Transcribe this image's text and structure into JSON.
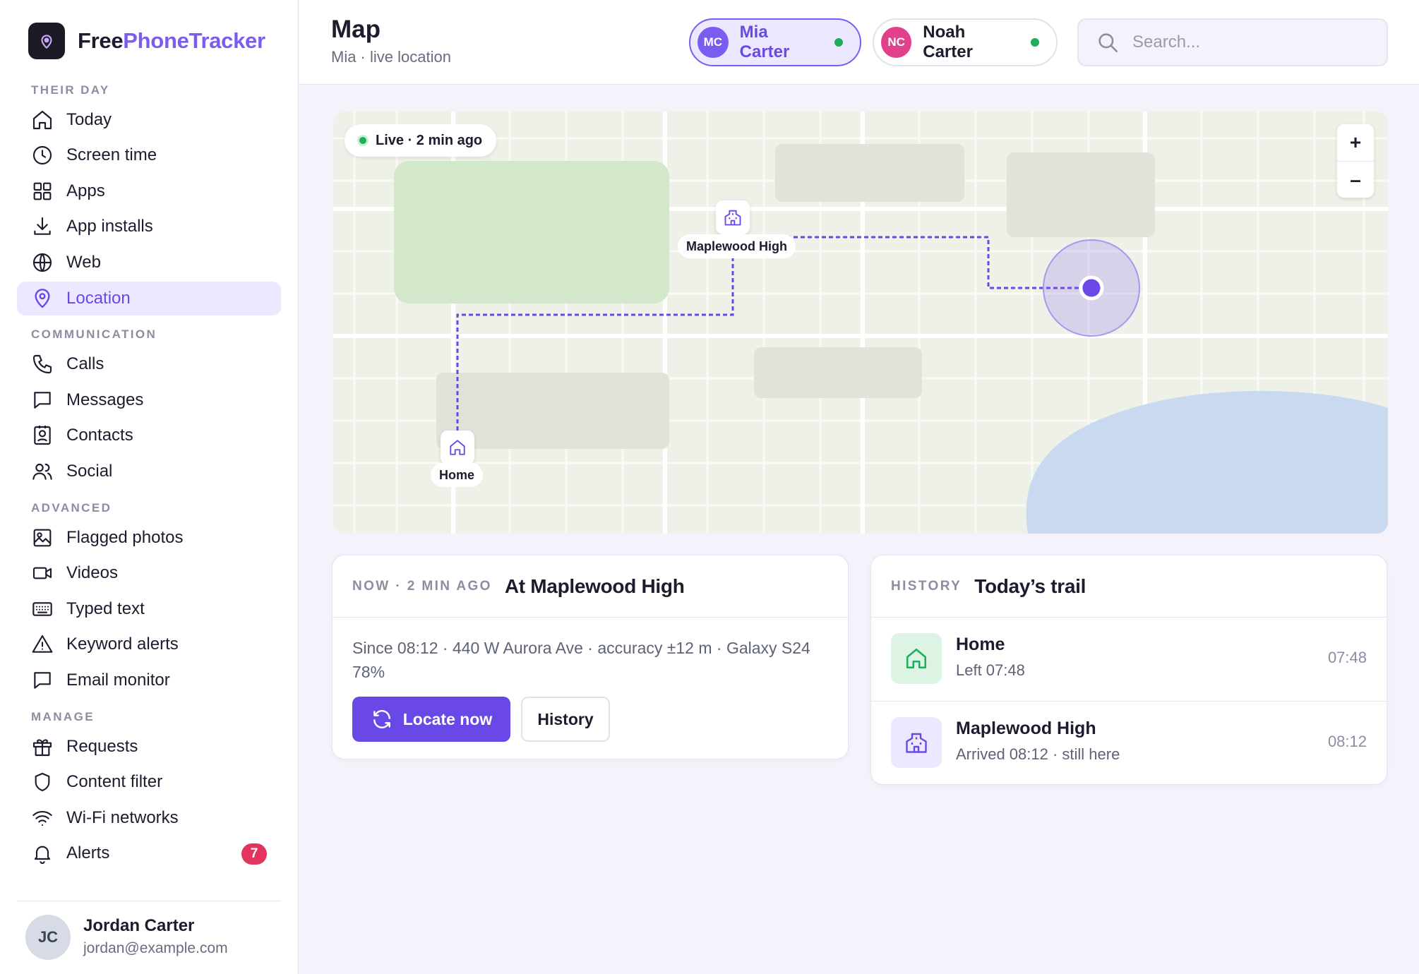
{
  "brand": {
    "name_a": "Free",
    "name_b": "PhoneTracker"
  },
  "nav": {
    "sections": [
      {
        "title": "THEIR DAY",
        "items": [
          {
            "label": "Today",
            "icon": "home-icon"
          },
          {
            "label": "Screen time",
            "icon": "clock-icon"
          },
          {
            "label": "Apps",
            "icon": "grid-icon"
          },
          {
            "label": "App installs",
            "icon": "download-icon"
          },
          {
            "label": "Web",
            "icon": "globe-icon"
          },
          {
            "label": "Location",
            "icon": "location-pin-icon",
            "active": true
          }
        ]
      },
      {
        "title": "COMMUNICATION",
        "items": [
          {
            "label": "Calls",
            "icon": "phone-icon"
          },
          {
            "label": "Messages",
            "icon": "message-icon"
          },
          {
            "label": "Contacts",
            "icon": "contact-card-icon"
          },
          {
            "label": "Social",
            "icon": "users-icon"
          }
        ]
      },
      {
        "title": "ADVANCED",
        "items": [
          {
            "label": "Flagged photos",
            "icon": "image-icon"
          },
          {
            "label": "Videos",
            "icon": "video-icon"
          },
          {
            "label": "Typed text",
            "icon": "keyboard-icon"
          },
          {
            "label": "Keyword alerts",
            "icon": "warning-icon"
          },
          {
            "label": "Email monitor",
            "icon": "message-icon"
          }
        ]
      },
      {
        "title": "MANAGE",
        "items": [
          {
            "label": "Requests",
            "icon": "gift-icon"
          },
          {
            "label": "Content filter",
            "icon": "shield-icon"
          },
          {
            "label": "Wi-Fi networks",
            "icon": "wifi-icon"
          },
          {
            "label": "Alerts",
            "icon": "bell-icon",
            "badge": "7"
          }
        ]
      }
    ]
  },
  "user": {
    "initials": "JC",
    "name": "Jordan Carter",
    "email": "jordan@example.com"
  },
  "header": {
    "title": "Map",
    "subtitle": "Mia · live location",
    "kids": [
      {
        "initials": "MC",
        "name": "Mia Carter",
        "active": true,
        "color": "#7b5cf0"
      },
      {
        "initials": "NC",
        "name": "Noah Carter",
        "active": false,
        "color": "#e0418a"
      }
    ],
    "search_placeholder": "Search..."
  },
  "map": {
    "live_label": "Live · 2 min ago",
    "zoom_in": "+",
    "zoom_out": "–",
    "places": [
      {
        "label": "Maplewood High",
        "icon": "school-icon"
      },
      {
        "label": "Home",
        "icon": "home-icon"
      }
    ]
  },
  "now_card": {
    "kicker": "NOW · 2 MIN AGO",
    "title": "At Maplewood High",
    "description": "Since 08:12 · 440 W Aurora Ave · accuracy ±12 m · Galaxy S24 78%",
    "locate_label": "Locate now",
    "history_label": "History"
  },
  "history_card": {
    "kicker": "HISTORY",
    "title": "Today’s trail",
    "rows": [
      {
        "title": "Home",
        "sub": "Left 07:48",
        "time": "07:48",
        "icon": "home-icon"
      },
      {
        "title": "Maplewood High",
        "sub": "Arrived 08:12 · still here",
        "time": "08:12",
        "icon": "school-icon"
      }
    ]
  },
  "colors": {
    "accent": "#6a48e8",
    "live": "#1fae5b",
    "alert": "#e3345f"
  }
}
